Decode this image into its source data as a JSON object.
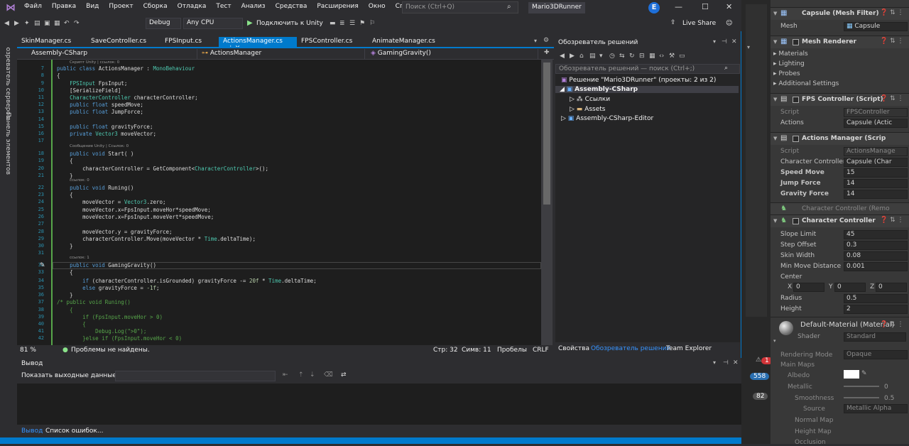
{
  "app": {
    "menu": [
      "Файл",
      "Правка",
      "Вид",
      "Проект",
      "Сборка",
      "Отладка",
      "Тест",
      "Анализ",
      "Средства",
      "Расширения",
      "Окно",
      "Справка"
    ],
    "search_placeholder": "Поиск (Ctrl+Q)",
    "solution_name": "Mario3DRunner",
    "avatar_letter": "E",
    "live_share": "Live Share"
  },
  "toolbar": {
    "config": "Debug",
    "platform": "Any CPU",
    "attach": "Подключить к Unity"
  },
  "tabs": [
    {
      "label": "SkinManager.cs"
    },
    {
      "label": "SaveController.cs"
    },
    {
      "label": "FPSInput.cs"
    },
    {
      "label": "ActionsManager.cs"
    },
    {
      "label": "FPSController.cs"
    },
    {
      "label": "AnimateManager.cs"
    }
  ],
  "navbar": {
    "project": "Assembly-CSharp",
    "class": "ActionsManager",
    "member": "GamingGravity()"
  },
  "side_panels": [
    "Обозреватель серверов",
    "Панель элементов"
  ],
  "code": {
    "lines": [
      {
        "n": "7",
        "t": "public class ActionsManager : MonoBehaviour"
      },
      {
        "n": "8",
        "t": "{"
      },
      {
        "n": "9",
        "t": "    FPSInput FpsInput;"
      },
      {
        "n": "10",
        "t": "    [SerializeField]"
      },
      {
        "n": "11",
        "t": "    CharacterController characterController;"
      },
      {
        "n": "12",
        "t": "    public float speedMove;"
      },
      {
        "n": "13",
        "t": "    public float JumpForce;"
      },
      {
        "n": "14",
        "t": ""
      },
      {
        "n": "15",
        "t": "    public float gravityForce;"
      },
      {
        "n": "16",
        "t": "    private Vector3 moveVector;"
      },
      {
        "n": "17",
        "t": ""
      },
      {
        "n": "18",
        "t": "    public void Start( )"
      },
      {
        "n": "19",
        "t": "    {"
      },
      {
        "n": "20",
        "t": "        characterController = GetComponent<CharacterController>();"
      },
      {
        "n": "21",
        "t": "    }"
      },
      {
        "n": "22",
        "t": "    public void Runing()"
      },
      {
        "n": "23",
        "t": "    {"
      },
      {
        "n": "24",
        "t": "        moveVector = Vector3.zero;"
      },
      {
        "n": "25",
        "t": "        moveVector.x=FpsInput.moveHor*speedMove;"
      },
      {
        "n": "26",
        "t": "        moveVector.x=FpsInput.moveVert*speedMove;"
      },
      {
        "n": "27",
        "t": ""
      },
      {
        "n": "28",
        "t": "        moveVector.y = gravityForce;"
      },
      {
        "n": "29",
        "t": "        characterController.Move(moveVector * Time.deltaTime);"
      },
      {
        "n": "30",
        "t": "    }"
      },
      {
        "n": "31",
        "t": ""
      },
      {
        "n": "32",
        "t": "    public void GamingGravity()"
      },
      {
        "n": "33",
        "t": "    {"
      },
      {
        "n": "34",
        "t": "        if (characterController.isGrounded) gravityForce -= 20f * Time.deltaTime;"
      },
      {
        "n": "35",
        "t": "        else gravityForce = -1f;"
      },
      {
        "n": "36",
        "t": "    }"
      },
      {
        "n": "37",
        "t": "/* public void Runing()"
      },
      {
        "n": "38",
        "t": "    {"
      },
      {
        "n": "39",
        "t": "        if (FpsInput.moveHor > 0)"
      },
      {
        "n": "40",
        "t": "        {"
      },
      {
        "n": "41",
        "t": "            Debug.Log(\">0\");"
      },
      {
        "n": "42",
        "t": "        }else if (FpsInput.moveHor < 0)"
      }
    ],
    "hints": [
      {
        "text": "Скрипт Unity | ссылок: 0"
      },
      {
        "text": "Сообщение Unity | Ссылок: 0"
      },
      {
        "text": "ссылок: 0"
      },
      {
        "text": "ссылок: 1"
      }
    ]
  },
  "editor_status": {
    "zoom": "81 %",
    "problems": "Проблемы не найдены.",
    "line": "Стр: 32",
    "col": "Симв: 11",
    "spaces": "Пробелы",
    "eol": "CRLF"
  },
  "output": {
    "title": "Вывод",
    "show_from_label": "Показать выходные данные из:",
    "tabs": [
      "Вывод",
      "Список ошибок..."
    ]
  },
  "solution_explorer": {
    "title": "Обозреватель решений",
    "search_placeholder": "Обозреватель решений — поиск (Ctrl+;)",
    "solution": "Решение \"Mario3DRunner\" (проекты: 2 из 2)",
    "nodes": [
      "Assembly-CSharp",
      "Ссылки",
      "Assets",
      "Assembly-CSharp-Editor"
    ],
    "bottom_tabs": [
      "Свойства",
      "Обозреватель решений",
      "Team Explorer"
    ]
  },
  "badges": {
    "count1": "558",
    "count2": "82",
    "errors": "1"
  },
  "inspector": {
    "mesh_filter": {
      "title": "Capsule (Mesh Filter)",
      "mesh_label": "Mesh",
      "mesh_value": "Capsule"
    },
    "mesh_renderer": {
      "title": "Mesh Renderer",
      "items": [
        "Materials",
        "Lighting",
        "Probes",
        "Additional Settings"
      ]
    },
    "fps_controller": {
      "title": "FPS Controller (Script)",
      "script_label": "Script",
      "script_value": "FPSController",
      "actions_label": "Actions",
      "actions_value": "Capsule (Actic"
    },
    "actions_manager": {
      "title": "Actions Manager (Scrip",
      "script_label": "Script",
      "script_value": "ActionsManage",
      "cc_label": "Character Controller",
      "cc_value": "Capsule (Char",
      "speed_label": "Speed Move",
      "speed_value": "15",
      "jump_label": "Jump Force",
      "jump_value": "14",
      "gravity_label": "Gravity Force",
      "gravity_value": "14"
    },
    "cc_removed": {
      "title": "Character Controller (Remo"
    },
    "character_controller": {
      "title": "Character Controller",
      "slope_label": "Slope Limit",
      "slope_value": "45",
      "step_label": "Step Offset",
      "step_value": "0.3",
      "skin_label": "Skin Width",
      "skin_value": "0.08",
      "mindist_label": "Min Move Distance",
      "mindist_value": "0.001",
      "center_label": "Center",
      "cx_label": "X",
      "cx_value": "0",
      "cy_label": "Y",
      "cy_value": "0",
      "cz_label": "Z",
      "cz_value": "0",
      "radius_label": "Radius",
      "radius_value": "0.5",
      "height_label": "Height",
      "height_value": "2"
    },
    "material": {
      "title": "Default-Material (Material)",
      "shader_label": "Shader",
      "shader_value": "Standard",
      "rendering_label": "Rendering Mode",
      "rendering_value": "Opaque",
      "main_maps": "Main Maps",
      "albedo": "Albedo",
      "metallic": "Metallic",
      "metallic_value": "0",
      "smoothness": "Smoothness",
      "smoothness_value": "0.5",
      "source": "Source",
      "source_value": "Metallic Alpha",
      "normal": "Normal Map",
      "height": "Height Map",
      "occlusion": "Occlusion"
    }
  }
}
